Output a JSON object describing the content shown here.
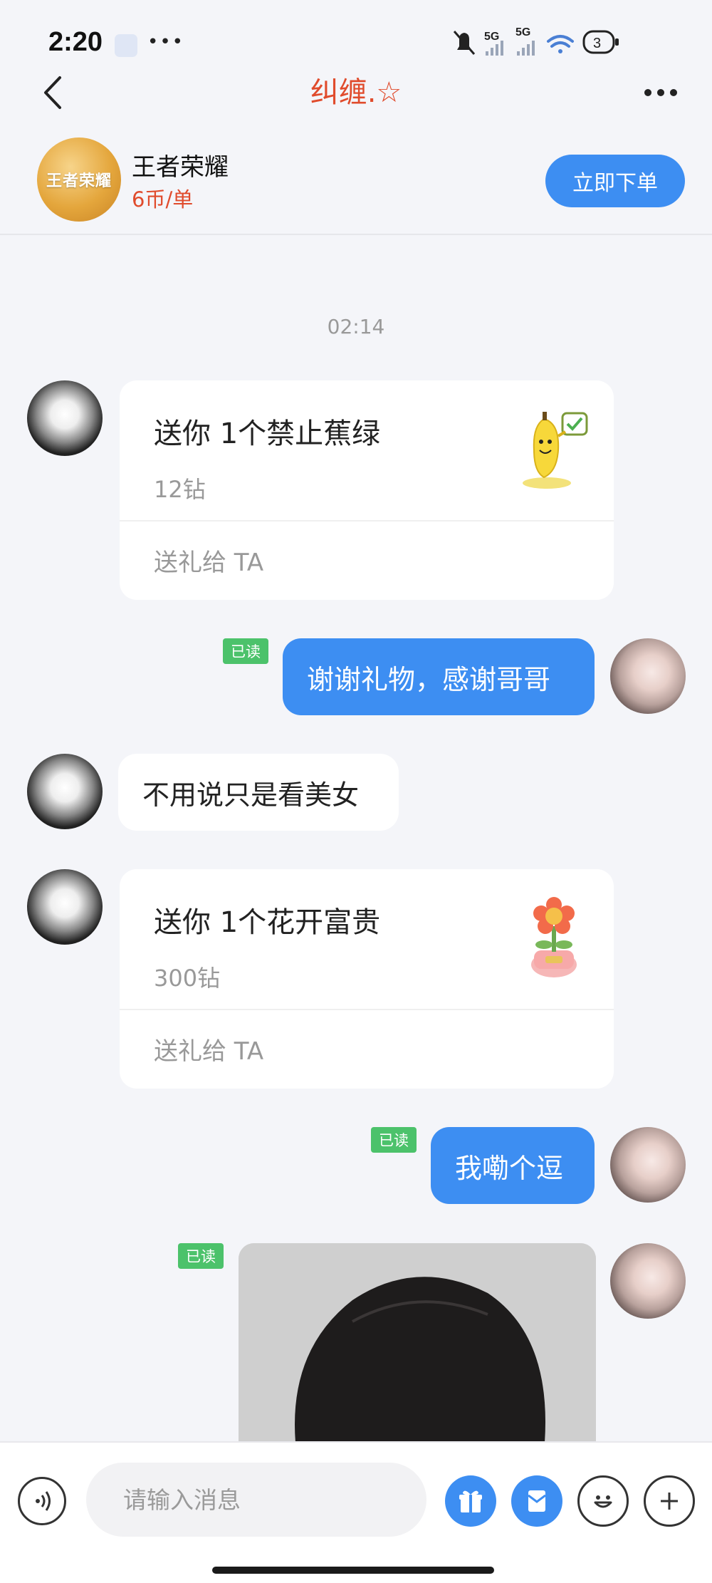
{
  "status_bar": {
    "time": "2:20",
    "signal_1": "5G",
    "signal_2": "5G",
    "battery": "3"
  },
  "nav": {
    "title": "纠缠.☆"
  },
  "game": {
    "logo_text": "王者荣耀",
    "name": "王者荣耀",
    "price": "6币/单",
    "order_label": "立即下单"
  },
  "chat": {
    "timestamp": "02:14",
    "gift1": {
      "title": "送你 1个禁止蕉绿",
      "price": "12钻",
      "send_label": "送礼给 TA",
      "icon": "banana-sticker-icon"
    },
    "msg_out_1": {
      "text": "谢谢礼物，感谢哥哥",
      "read": "已读"
    },
    "msg_in_1": {
      "text": "不用说只是看美女"
    },
    "gift2": {
      "title": "送你 1个花开富贵",
      "price": "300钻",
      "send_label": "送礼给 TA",
      "icon": "flower-pot-icon"
    },
    "msg_out_2": {
      "text": "我嘞个逗",
      "read": "已读"
    },
    "photo_msg": {
      "read": "已读"
    }
  },
  "input_bar": {
    "placeholder": "请输入消息"
  },
  "colors": {
    "accent": "#3d8ef2",
    "title_red": "#e04b2c",
    "read_green": "#4cc26b",
    "background": "#f4f5f9"
  }
}
